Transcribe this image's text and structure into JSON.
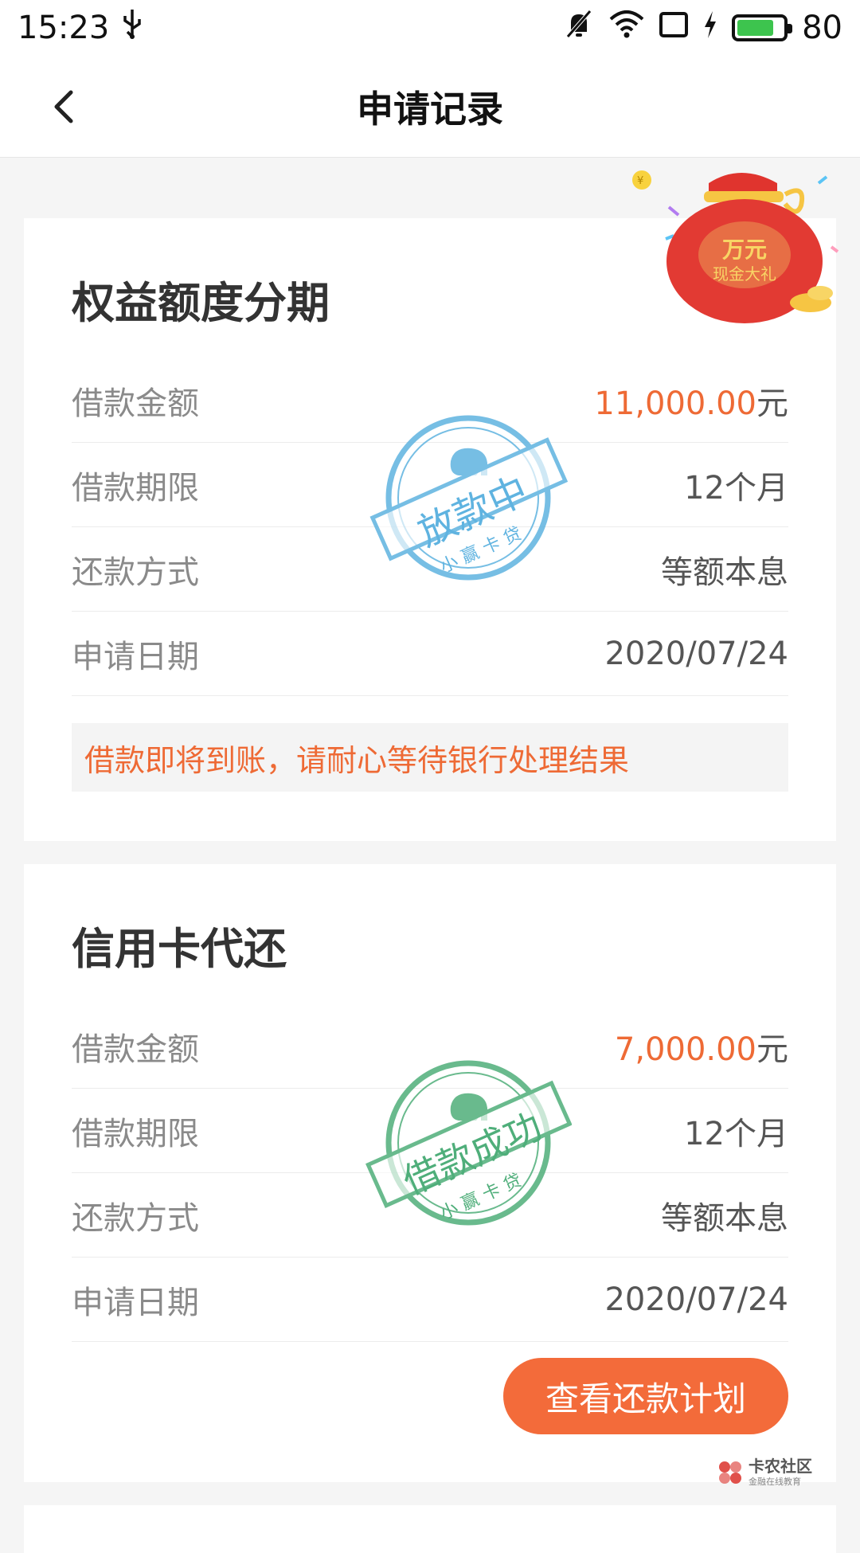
{
  "status_bar": {
    "time": "15:23",
    "battery_level": "80",
    "icons": [
      "usb-icon",
      "mute-bell-icon",
      "wifi-icon",
      "screen-rotate-icon",
      "charging-icon",
      "battery-icon"
    ]
  },
  "nav": {
    "title": "申请记录",
    "back_icon": "chevron-left-icon"
  },
  "promo": {
    "line1": "万元",
    "line2": "现金大礼"
  },
  "records": [
    {
      "title": "权益额度分期",
      "rows": [
        {
          "label": "借款金额",
          "amount": "11,000.00",
          "unit": "元"
        },
        {
          "label": "借款期限",
          "value": "12个月"
        },
        {
          "label": "还款方式",
          "value": "等额本息"
        },
        {
          "label": "申请日期",
          "value": "2020/07/24"
        }
      ],
      "stamp": {
        "status": "放款中",
        "brand": "小 赢 卡 贷",
        "color": "#5fb3e0"
      },
      "notice": "借款即将到账，请耐心等待银行处理结果"
    },
    {
      "title": "信用卡代还",
      "rows": [
        {
          "label": "借款金额",
          "amount": "7,000.00",
          "unit": "元"
        },
        {
          "label": "借款期限",
          "value": "12个月"
        },
        {
          "label": "还款方式",
          "value": "等额本息"
        },
        {
          "label": "申请日期",
          "value": "2020/07/24"
        }
      ],
      "stamp": {
        "status": "借款成功",
        "brand": "小 赢 卡 贷",
        "color": "#4fae7a"
      },
      "button": "查看还款计划"
    }
  ],
  "watermark": {
    "name": "卡农社区",
    "sub": "金融在线教育"
  },
  "colors": {
    "accent": "#f36b3a",
    "amount": "#ee6a35",
    "stamp_blue": "#5fb3e0",
    "stamp_green": "#4fae7a"
  }
}
